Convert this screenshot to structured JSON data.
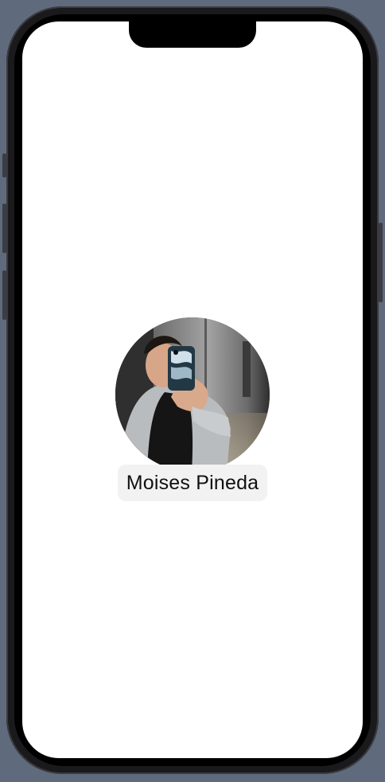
{
  "profile": {
    "name": "Moises Pineda",
    "avatar_icon": "profile-photo"
  },
  "colors": {
    "background": "#5f6b7c",
    "screen": "#ffffff",
    "chip": "#f2f2f3",
    "text": "#111111"
  }
}
